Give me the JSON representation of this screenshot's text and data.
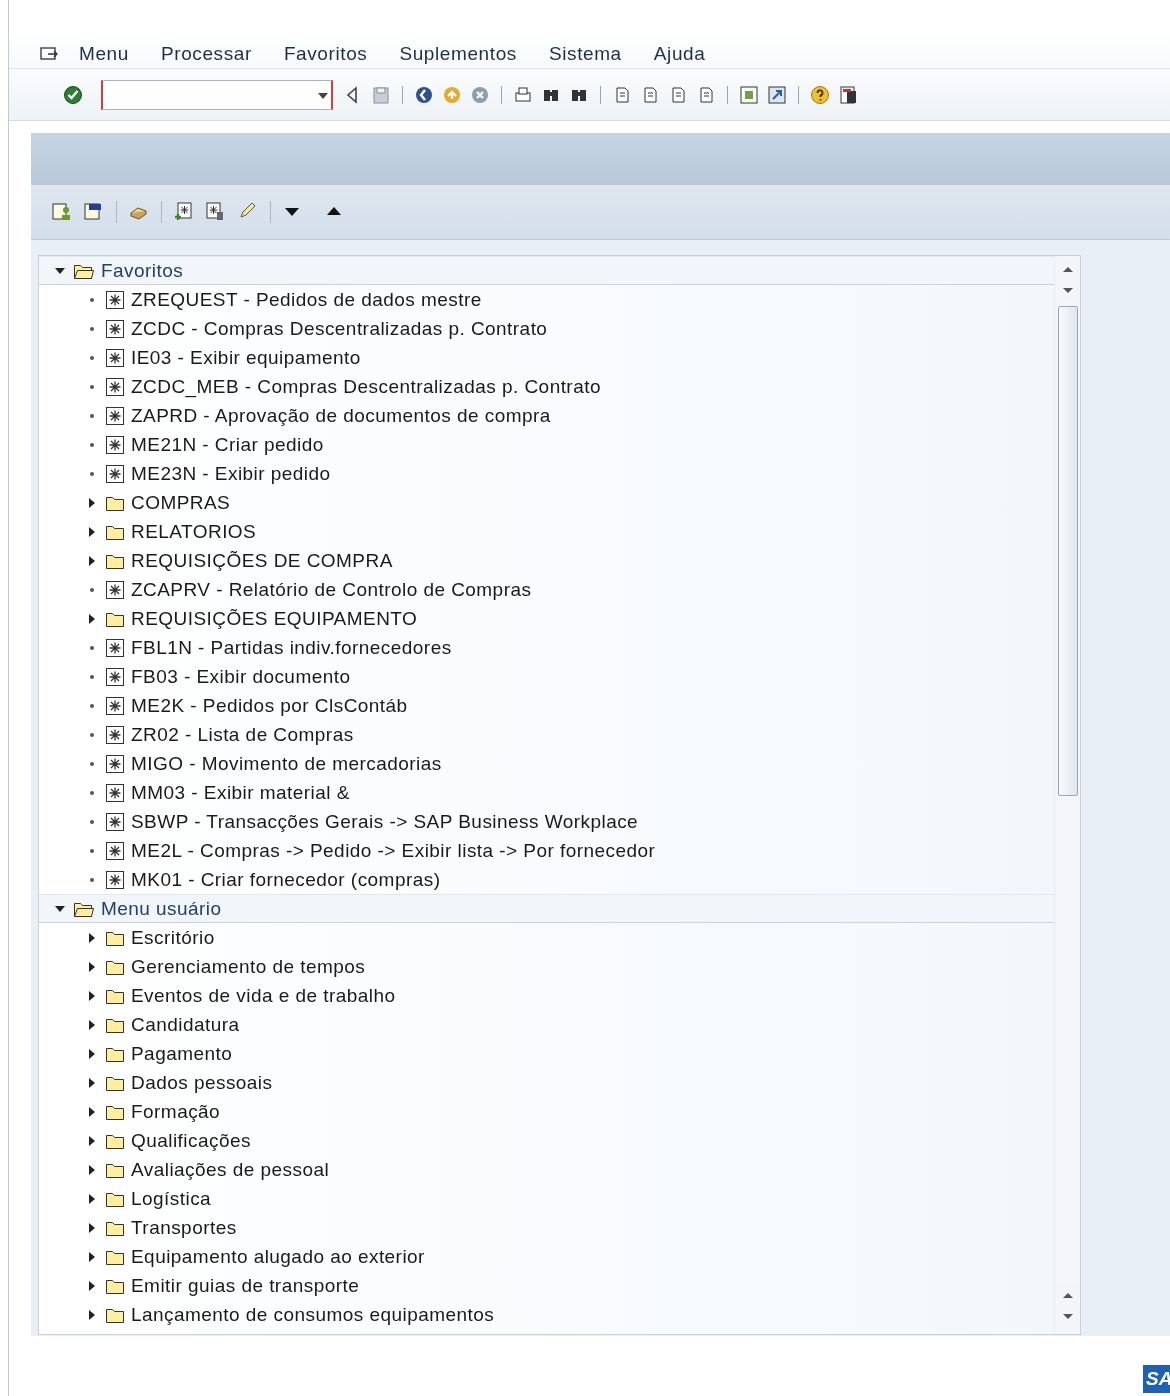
{
  "menu_bar": {
    "items": [
      "Menu",
      "Processar",
      "Favoritos",
      "Suplementos",
      "Sistema",
      "Ajuda"
    ]
  },
  "tree": [
    {
      "label": "Favoritos",
      "kind": "root",
      "expanded": true,
      "children": [
        {
          "label": "ZREQUEST - Pedidos de dados mestre",
          "kind": "transaction"
        },
        {
          "label": "ZCDC - Compras Descentralizadas p. Contrato",
          "kind": "transaction"
        },
        {
          "label": "IE03 - Exibir equipamento",
          "kind": "transaction"
        },
        {
          "label": "ZCDC_MEB - Compras Descentralizadas p. Contrato",
          "kind": "transaction"
        },
        {
          "label": "ZAPRD - Aprovação de documentos de compra",
          "kind": "transaction"
        },
        {
          "label": "ME21N - Criar pedido",
          "kind": "transaction"
        },
        {
          "label": "ME23N - Exibir pedido",
          "kind": "transaction"
        },
        {
          "label": "COMPRAS",
          "kind": "folder",
          "expanded": false
        },
        {
          "label": "RELATORIOS",
          "kind": "folder",
          "expanded": false
        },
        {
          "label": "REQUISIÇÕES DE COMPRA",
          "kind": "folder",
          "expanded": false
        },
        {
          "label": "ZCAPRV - Relatório de Controlo de Compras",
          "kind": "transaction"
        },
        {
          "label": "REQUISIÇÕES EQUIPAMENTO",
          "kind": "folder",
          "expanded": false
        },
        {
          "label": "FBL1N - Partidas indiv.fornecedores",
          "kind": "transaction"
        },
        {
          "label": "FB03 - Exibir documento",
          "kind": "transaction"
        },
        {
          "label": "ME2K - Pedidos por ClsContáb",
          "kind": "transaction"
        },
        {
          "label": "ZR02 - Lista de Compras",
          "kind": "transaction"
        },
        {
          "label": "MIGO - Movimento de mercadorias",
          "kind": "transaction"
        },
        {
          "label": "MM03 - Exibir material &",
          "kind": "transaction"
        },
        {
          "label": "SBWP - Transacções Gerais -> SAP Business Workplace",
          "kind": "transaction"
        },
        {
          "label": "ME2L - Compras -> Pedido -> Exibir lista -> Por fornecedor",
          "kind": "transaction"
        },
        {
          "label": "MK01 - Criar fornecedor (compras)",
          "kind": "transaction"
        }
      ]
    },
    {
      "label": "Menu usuário",
      "kind": "root",
      "expanded": true,
      "children": [
        {
          "label": "Escritório",
          "kind": "folder",
          "expanded": false
        },
        {
          "label": "Gerenciamento de tempos",
          "kind": "folder",
          "expanded": false
        },
        {
          "label": "Eventos de vida e de trabalho",
          "kind": "folder",
          "expanded": false
        },
        {
          "label": "Candidatura",
          "kind": "folder",
          "expanded": false
        },
        {
          "label": "Pagamento",
          "kind": "folder",
          "expanded": false
        },
        {
          "label": "Dados pessoais",
          "kind": "folder",
          "expanded": false
        },
        {
          "label": "Formação",
          "kind": "folder",
          "expanded": false
        },
        {
          "label": "Qualificações",
          "kind": "folder",
          "expanded": false
        },
        {
          "label": "Avaliações de pessoal",
          "kind": "folder",
          "expanded": false
        },
        {
          "label": "Logística",
          "kind": "folder",
          "expanded": false
        },
        {
          "label": "Transportes",
          "kind": "folder",
          "expanded": false
        },
        {
          "label": "Equipamento alugado ao exterior",
          "kind": "folder",
          "expanded": false
        },
        {
          "label": "Emitir guias de transporte",
          "kind": "folder",
          "expanded": false
        },
        {
          "label": "Lançamento de consumos equipamentos",
          "kind": "folder",
          "expanded": false
        }
      ]
    }
  ],
  "logo": {
    "text": "SA"
  }
}
